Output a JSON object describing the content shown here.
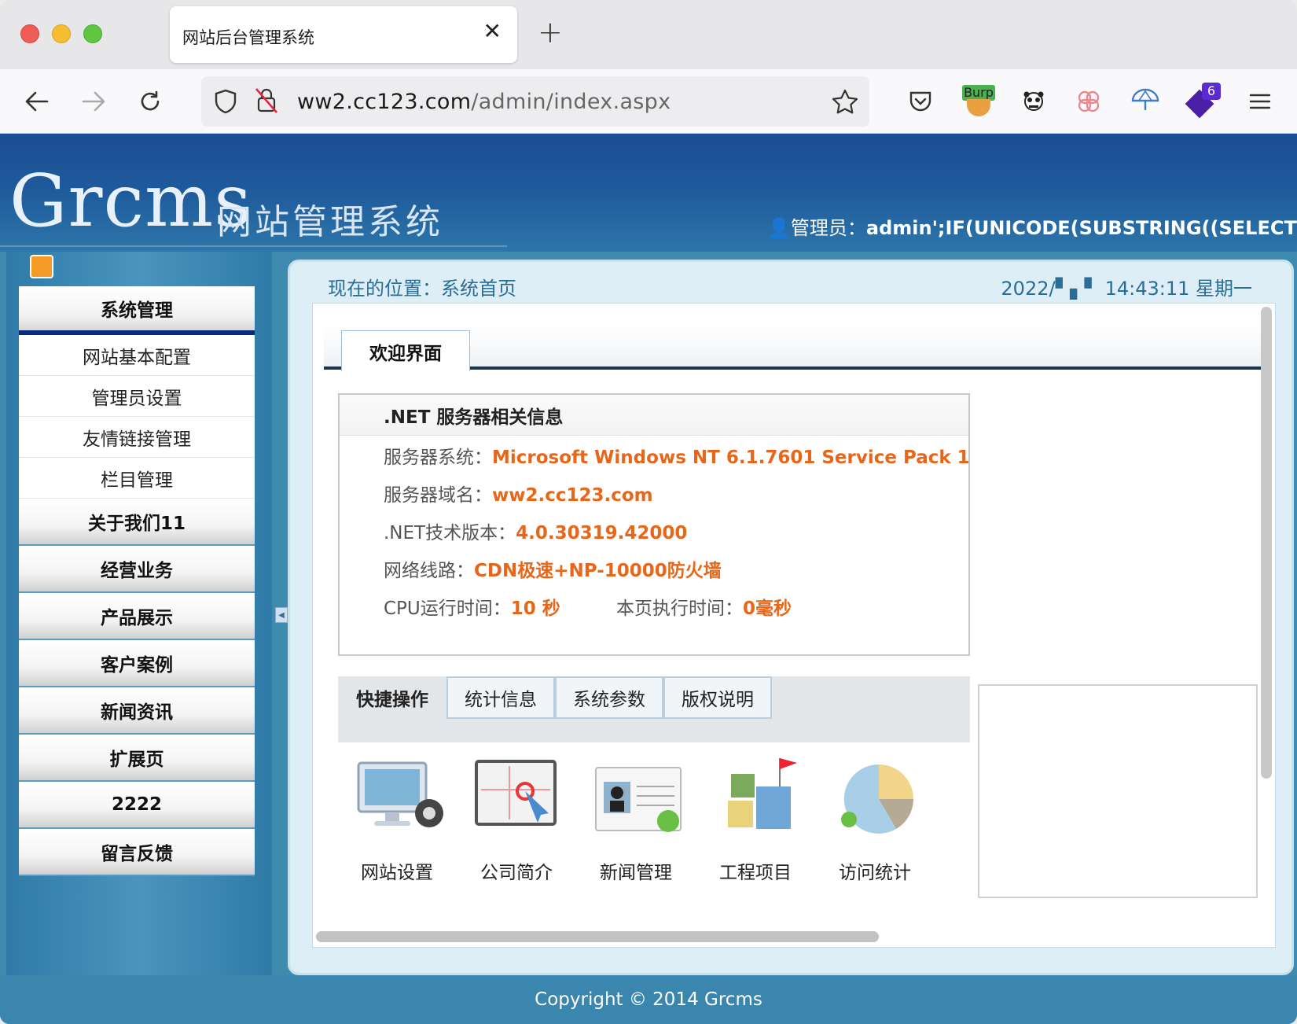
{
  "browser": {
    "tab_title": "网站后台管理系统",
    "url_host": "ww2.cc123.com",
    "url_path": "/admin/index.aspx",
    "burp_label": "Burp",
    "badge_count": "6"
  },
  "header": {
    "logo": "Grcms",
    "logo_sub": "网站管理系统",
    "admin_label": "管理员：",
    "admin_name": "admin';IF(UNICODE(SUBSTRING((SELECT"
  },
  "sidebar": {
    "head": "系统管理",
    "subitems": [
      "网站基本配置",
      "管理员设置",
      "友情链接管理",
      "栏目管理"
    ],
    "items": [
      "关于我们11",
      "经营业务",
      "产品展示",
      "客户案例",
      "新闻资讯",
      "扩展页",
      "2222",
      "留言反馈"
    ]
  },
  "main": {
    "breadcrumb": "现在的位置：系统首页",
    "datetime": "2022/▘▖▘ 14:43:11 星期一",
    "welcome_tab": "欢迎界面",
    "info_title": ".NET 服务器相关信息",
    "info": {
      "os_label": "服务器系统：",
      "os_value": "Microsoft Windows NT 6.1.7601 Service Pack 1",
      "domain_label": "服务器域名：",
      "domain_value": "ww2.cc123.com",
      "net_label": ".NET技术版本：",
      "net_value": "4.0.30319.42000",
      "line_label": "网络线路：",
      "line_value": "CDN极速+NP-10000防火墙",
      "cpu_label": "CPU运行时间：",
      "cpu_value": "10 秒",
      "exec_label": "本页执行时间：",
      "exec_value": "0毫秒"
    },
    "quick_tabs": [
      "快捷操作",
      "统计信息",
      "系统参数",
      "版权说明"
    ],
    "quick_icons": [
      "网站设置",
      "公司简介",
      "新闻管理",
      "工程项目",
      "访问统计"
    ]
  },
  "footer": "Copyright © 2014 Grcms"
}
